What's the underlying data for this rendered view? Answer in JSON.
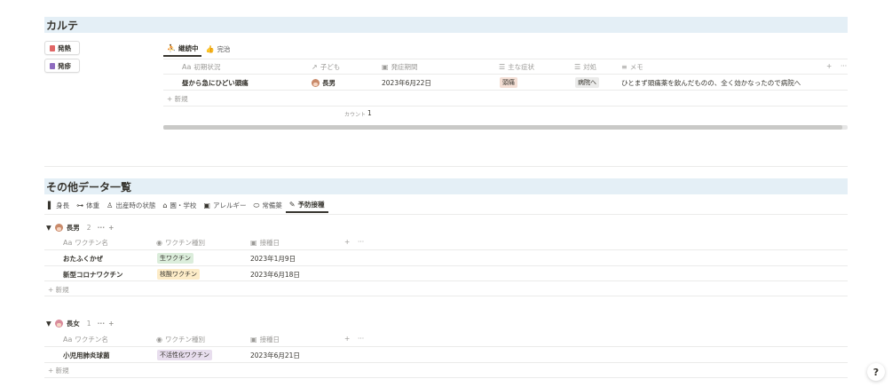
{
  "karte": {
    "title": "カルテ",
    "buttons": [
      {
        "label": "発熱",
        "color": "#e06666"
      },
      {
        "label": "発疹",
        "color": "#8e6bbf"
      }
    ],
    "tabs": [
      "継続中",
      "完治"
    ],
    "columns": [
      "初期状況",
      "子ども",
      "発症期間",
      "主な症状",
      "対処",
      "メモ"
    ],
    "row": {
      "initial": "昼から急にひどい頭痛",
      "child": "長男",
      "period": "2023年6月22日",
      "symptom": "頭痛",
      "action": "病院へ",
      "memo": "ひとまず頭痛薬を飲んだものの、全く効かなったので病院へ"
    },
    "new_label": "新規",
    "count_label": "カウント",
    "count_value": "1"
  },
  "other": {
    "title": "その他データ一覧",
    "tabs": [
      "身長",
      "体重",
      "出産時の状態",
      "園・学校",
      "アレルギー",
      "常備薬",
      "予防接種"
    ],
    "columns": [
      "ワクチン名",
      "ワクチン種別",
      "接種日"
    ],
    "groups": [
      {
        "name": "長男",
        "count": "2",
        "rows": [
          {
            "name": "おたふくかぜ",
            "type": "生ワクチン",
            "type_color": "#dbeddb",
            "date": "2023年1月9日"
          },
          {
            "name": "新型コロナワクチン",
            "type": "核酸ワクチン",
            "type_color": "#fdecc8",
            "date": "2023年6月18日"
          }
        ]
      },
      {
        "name": "長女",
        "count": "1",
        "rows": [
          {
            "name": "小児用肺炎球菌",
            "type": "不活性化ワクチン",
            "type_color": "#e8deee",
            "date": "2023年6月21日"
          }
        ]
      }
    ],
    "new_label": "新規"
  },
  "help_label": "?"
}
